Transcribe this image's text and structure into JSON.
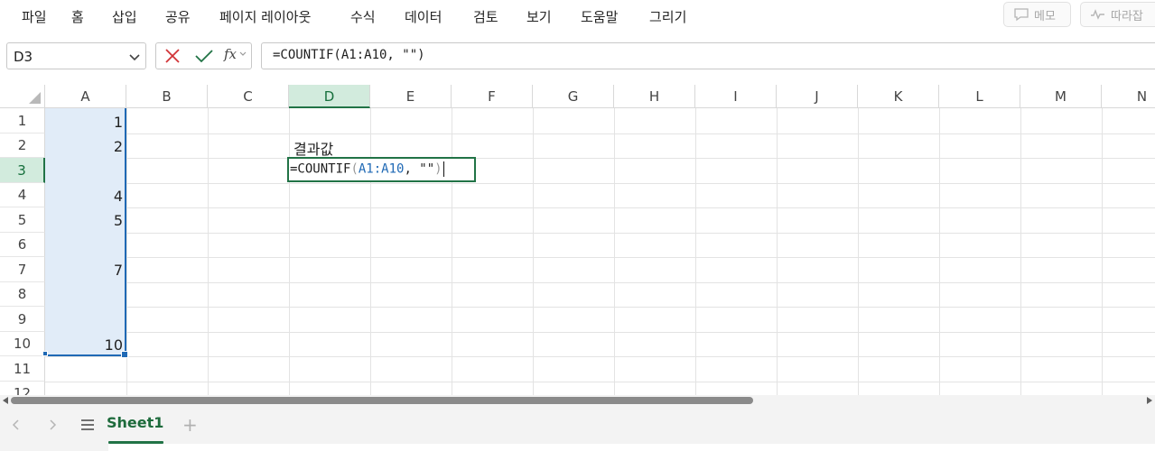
{
  "menu": {
    "tabs": [
      "파일",
      "홈",
      "삽입",
      "공유",
      "페이지 레이아웃",
      "수식",
      "데이터",
      "검토",
      "보기",
      "도움말",
      "그리기"
    ],
    "memo_label": "메모",
    "follow_label": "따라잡"
  },
  "formula_bar": {
    "name_box": "D3",
    "fx_label": "fx",
    "formula": "=COUNTIF(A1:A10, \"\")"
  },
  "columns": [
    "A",
    "B",
    "C",
    "D",
    "E",
    "F",
    "G",
    "H",
    "I",
    "J",
    "K",
    "L",
    "M",
    "N"
  ],
  "rows": [
    "1",
    "2",
    "3",
    "4",
    "5",
    "6",
    "7",
    "8",
    "9",
    "10",
    "11",
    "12"
  ],
  "selected_column": "D",
  "selected_row": "3",
  "cells": {
    "A1": "1",
    "A2": "2",
    "A4": "4",
    "A5": "5",
    "A7": "7",
    "A10": "10",
    "D2": "결과값"
  },
  "edit_cell": {
    "ref": "D3",
    "prefix": "=COUNTIF",
    "open_paren": "(",
    "range_ref": "A1:A10",
    "rest": ", \"\"",
    "close_paren": ")"
  },
  "sheets": {
    "tabs": [
      "Sheet1"
    ],
    "active": "Sheet1",
    "add_label": "+"
  },
  "colors": {
    "accent_green": "#217346",
    "selection_blue": "#1f69b5",
    "selection_fill": "#e1ecf8"
  }
}
